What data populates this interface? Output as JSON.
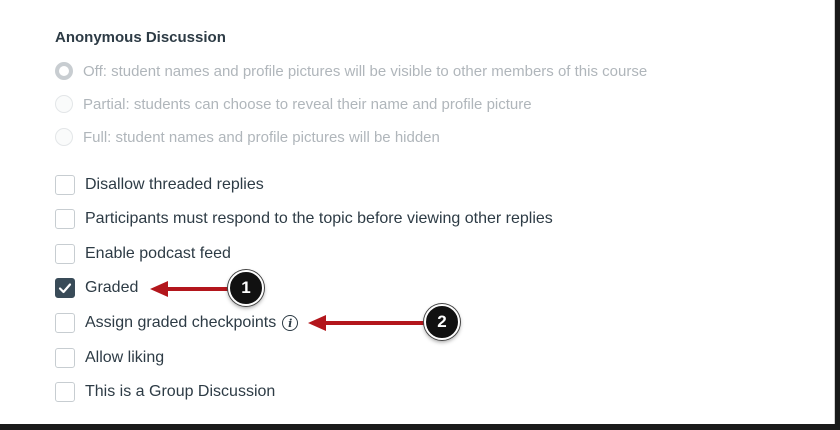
{
  "anonymous": {
    "heading": "Anonymous Discussion",
    "options": [
      {
        "label": "Off: student names and profile pictures will be visible to other members of this course",
        "selected": true
      },
      {
        "label": "Partial: students can choose to reveal their name and profile picture",
        "selected": false
      },
      {
        "label": "Full: student names and profile pictures will be hidden",
        "selected": false
      }
    ]
  },
  "options": {
    "disallow_threaded": {
      "label": "Disallow threaded replies",
      "checked": false
    },
    "must_respond": {
      "label": "Participants must respond to the topic before viewing other replies",
      "checked": false
    },
    "podcast": {
      "label": "Enable podcast feed",
      "checked": false
    },
    "graded": {
      "label": "Graded",
      "checked": true
    },
    "checkpoints": {
      "label": "Assign graded checkpoints",
      "checked": false,
      "info_icon": "info-icon"
    },
    "liking": {
      "label": "Allow liking",
      "checked": false
    },
    "group": {
      "label": "This is a Group Discussion",
      "checked": false
    }
  },
  "annotations": {
    "callout_1": "1",
    "callout_2": "2",
    "arrow_color": "#b3161c"
  }
}
